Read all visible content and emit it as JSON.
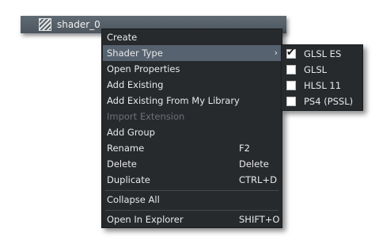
{
  "tree": {
    "icon": "shader-icon",
    "label": "shader_0"
  },
  "menu": {
    "items": [
      {
        "label": "Create",
        "shortcut": ""
      },
      {
        "label": "Shader Type",
        "shortcut": "",
        "submenu": true,
        "highlighted": true
      },
      {
        "label": "Open Properties",
        "shortcut": ""
      },
      {
        "label": "Add Existing",
        "shortcut": ""
      },
      {
        "label": "Add Existing From My Library",
        "shortcut": ""
      },
      {
        "label": "Import Extension",
        "shortcut": "",
        "disabled": true
      },
      {
        "label": "Add Group",
        "shortcut": ""
      },
      {
        "label": "Rename",
        "shortcut": "F2"
      },
      {
        "label": "Delete",
        "shortcut": "Delete"
      },
      {
        "label": "Duplicate",
        "shortcut": "CTRL+D"
      },
      {
        "label": "Collapse All",
        "shortcut": ""
      },
      {
        "label": "Open In Explorer",
        "shortcut": "SHIFT+O"
      }
    ],
    "submenu_arrow": "›"
  },
  "shader_type_submenu": {
    "items": [
      {
        "label": "GLSL ES",
        "checked": true
      },
      {
        "label": "GLSL",
        "checked": false
      },
      {
        "label": "HLSL 11",
        "checked": false
      },
      {
        "label": "PS4 (PSSL)",
        "checked": false
      }
    ],
    "check_glyph": "✔"
  }
}
